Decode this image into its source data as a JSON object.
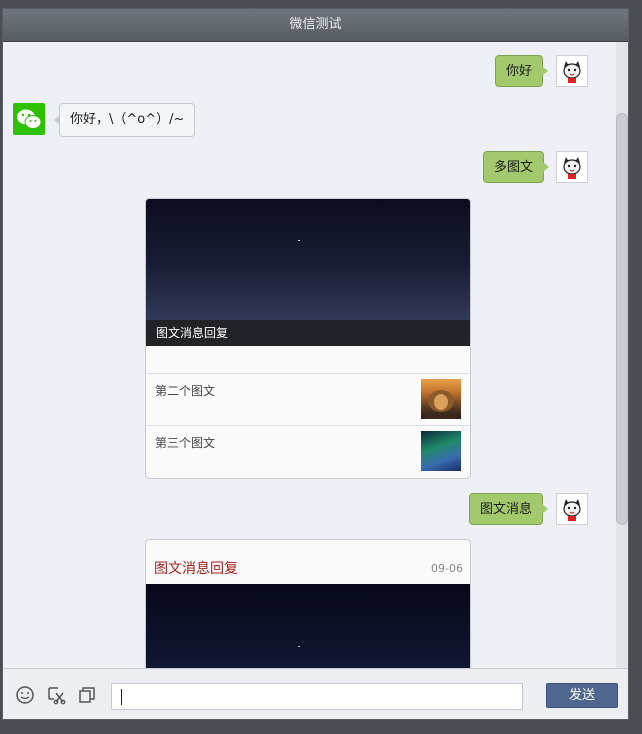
{
  "window": {
    "title": "微信测试"
  },
  "messages": {
    "m1": {
      "text": "你好"
    },
    "m2": {
      "text": "你好，\\（^o^）/~"
    },
    "m3": {
      "text": "多图文"
    },
    "m4": {
      "text": "图文消息"
    }
  },
  "news_card": {
    "main_title": "图文消息回复",
    "items": [
      {
        "title": "第二个图文",
        "thumb": "lion-image"
      },
      {
        "title": "第三个图文",
        "thumb": "aurora-image"
      }
    ]
  },
  "news_card_single": {
    "title": "图文消息回复",
    "date": "09-06"
  },
  "composer": {
    "send_label": "发送",
    "icons": [
      "emoji-icon",
      "screenshot-icon",
      "copy-icon"
    ]
  },
  "colors": {
    "my_bubble": "#a3c96d",
    "send_button": "#4f6790",
    "wechat_green": "#2dc100",
    "card_title_red": "#a6201a"
  }
}
